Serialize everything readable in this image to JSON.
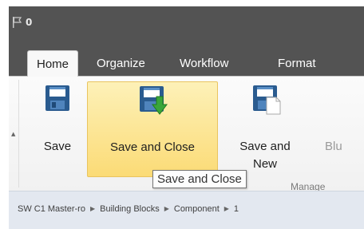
{
  "window": {
    "title_count": "0"
  },
  "tabs": [
    {
      "label": "Home",
      "active": true
    },
    {
      "label": "Organize"
    },
    {
      "label": "Workflow"
    },
    {
      "label": "Format"
    }
  ],
  "ribbon": {
    "save": "Save",
    "save_close": "Save and Close",
    "save_new": "Save and\nNew",
    "partial": "Blu",
    "group_label": "Manage"
  },
  "tooltip": {
    "text": "Save and Close"
  },
  "breadcrumb": [
    "SW C1 Master-ro",
    "Building Blocks",
    "Component",
    "1"
  ],
  "colors": {
    "titlebar": "#535353",
    "highlight": "#fbdb76",
    "breadcrumb_bg": "#e3e8f0"
  }
}
